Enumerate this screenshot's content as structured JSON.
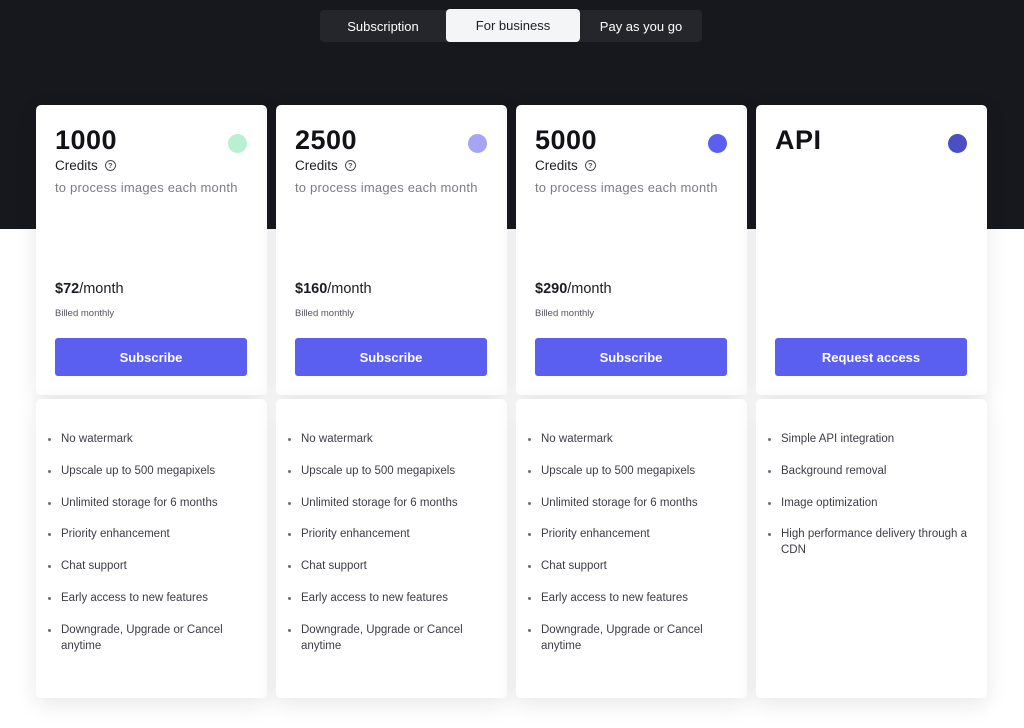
{
  "tabs": [
    {
      "label": "Subscription",
      "active": false
    },
    {
      "label": "For business",
      "active": true
    },
    {
      "label": "Pay as you go",
      "active": false
    }
  ],
  "plans": [
    {
      "amount": "1000",
      "unit": "Credits",
      "description": "to process images each month",
      "price": "$72",
      "period": "/month",
      "billing": "Billed monthly",
      "button": "Subscribe",
      "dot_color": "#b8f0d0",
      "features": [
        "No watermark",
        "Upscale up to 500 megapixels",
        "Unlimited storage for 6 months",
        "Priority enhancement",
        "Chat support",
        "Early access to new features",
        "Downgrade, Upgrade or Cancel anytime"
      ]
    },
    {
      "amount": "2500",
      "unit": "Credits",
      "description": "to process images each month",
      "price": "$160",
      "period": "/month",
      "billing": "Billed monthly",
      "button": "Subscribe",
      "dot_color": "#a4a6f5",
      "features": [
        "No watermark",
        "Upscale up to 500 megapixels",
        "Unlimited storage for 6 months",
        "Priority enhancement",
        "Chat support",
        "Early access to new features",
        "Downgrade, Upgrade or Cancel anytime"
      ]
    },
    {
      "amount": "5000",
      "unit": "Credits",
      "description": "to process images each month",
      "price": "$290",
      "period": "/month",
      "billing": "Billed monthly",
      "button": "Subscribe",
      "dot_color": "#5a5ff0",
      "features": [
        "No watermark",
        "Upscale up to 500 megapixels",
        "Unlimited storage for 6 months",
        "Priority enhancement",
        "Chat support",
        "Early access to new features",
        "Downgrade, Upgrade or Cancel anytime"
      ]
    },
    {
      "amount": "API",
      "button": "Request access",
      "dot_color": "#4a4fc4",
      "features": [
        "Simple API integration",
        "Background removal",
        "Image optimization",
        "High performance delivery through a CDN"
      ]
    }
  ],
  "colors": {
    "accent": "#5a5ff0",
    "dark_background": "#17181d"
  }
}
